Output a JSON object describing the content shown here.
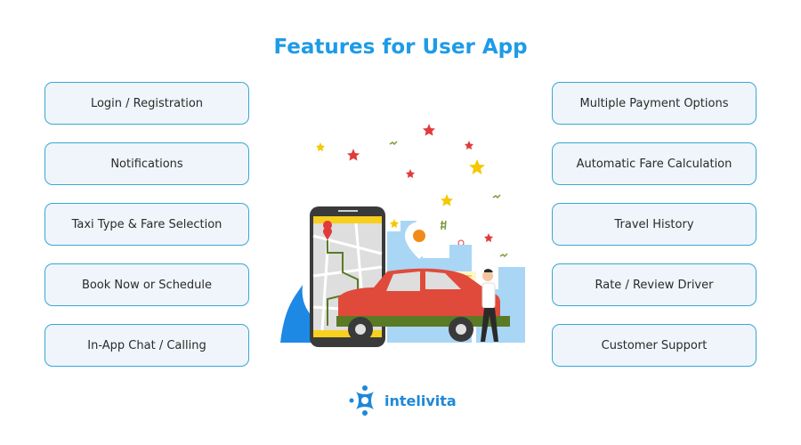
{
  "title": "Features for User App",
  "left_features": [
    {
      "label": "Login / Registration"
    },
    {
      "label": "Notifications"
    },
    {
      "label": "Taxi Type & Fare Selection"
    },
    {
      "label": "Book Now or Schedule"
    },
    {
      "label": "In-App Chat / Calling"
    }
  ],
  "right_features": [
    {
      "label": "Multiple Payment Options"
    },
    {
      "label": "Automatic Fare Calculation"
    },
    {
      "label": "Travel History"
    },
    {
      "label": "Rate / Review Driver"
    },
    {
      "label": "Customer Support"
    }
  ],
  "illustration": {
    "description": "taxi-booking-illustration",
    "icons": [
      "smartphone-map-icon",
      "map-pin-icon",
      "taxi-car-icon",
      "person-icon",
      "city-skyline-icon",
      "star-icon",
      "chat-bubble-icon"
    ]
  },
  "brand": {
    "name": "intelivita",
    "logo_icon": "intelivita-logo-icon",
    "color": "#1e88d8"
  },
  "colors": {
    "title": "#1e9be6",
    "box_border": "#3aa6d6",
    "box_fill": "#eff5fa",
    "text": "#2a2a2a"
  }
}
